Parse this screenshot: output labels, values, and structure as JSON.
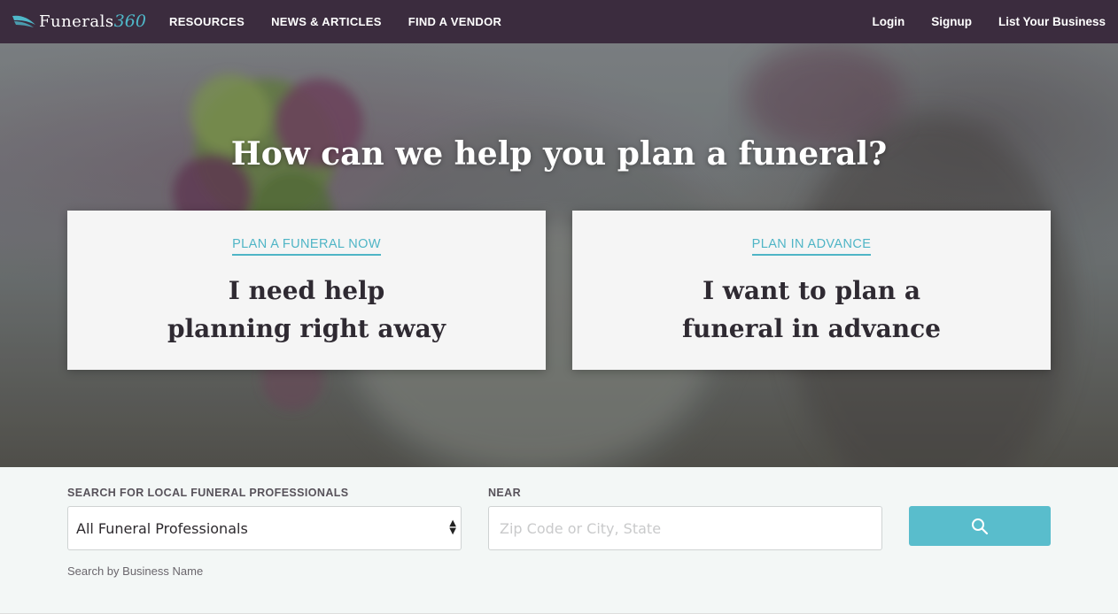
{
  "brand": {
    "name": "Funerals",
    "number": "360"
  },
  "nav": {
    "left": [
      "RESOURCES",
      "NEWS & ARTICLES",
      "FIND A VENDOR"
    ],
    "right": [
      "Login",
      "Signup",
      "List Your Business"
    ]
  },
  "hero": {
    "title": "How can we help you plan a funeral?",
    "cards": [
      {
        "kicker": "PLAN A FUNERAL NOW",
        "line1": "I need help",
        "line2": "planning right away"
      },
      {
        "kicker": "PLAN IN ADVANCE",
        "line1": "I want to plan a",
        "line2": "funeral in advance"
      }
    ]
  },
  "search": {
    "category_label": "SEARCH FOR LOCAL FUNERAL PROFESSIONALS",
    "category_value": "All Funeral Professionals",
    "near_label": "NEAR",
    "near_placeholder": "Zip Code or City, State",
    "business_link": "Search by Business Name",
    "button_icon": "search-icon"
  },
  "colors": {
    "nav_bg": "#3b2c3e",
    "accent": "#4fb5c6",
    "button": "#59bdcc"
  }
}
